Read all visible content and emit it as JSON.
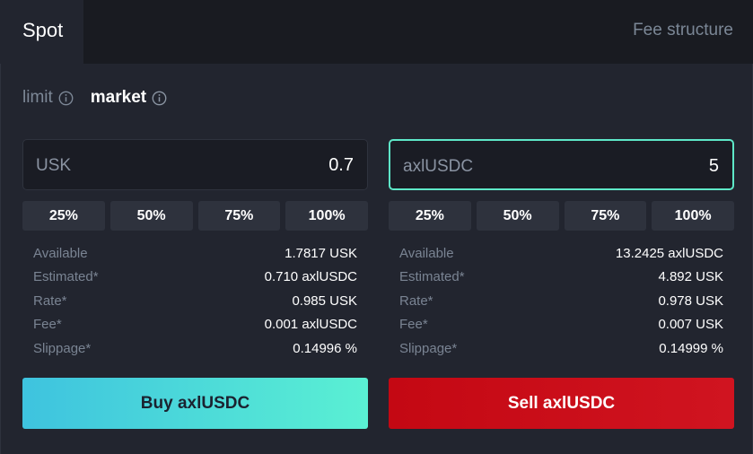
{
  "tabs": {
    "active": "Spot",
    "fee_link": "Fee structure"
  },
  "modes": {
    "limit": "limit",
    "market": "market",
    "selected": "market"
  },
  "colors": {
    "accent": "#5ee8c8",
    "buy": "#4ad8d8",
    "sell": "#c40813",
    "background": "#22252f"
  },
  "left": {
    "asset": "USK",
    "amount": "0.7",
    "percent_buttons": [
      "25%",
      "50%",
      "75%",
      "100%"
    ],
    "rows": [
      {
        "label": "Available",
        "value": "1.7817 USK"
      },
      {
        "label": "Estimated*",
        "value": "0.710 axlUSDC"
      },
      {
        "label": "Rate*",
        "value": "0.985 USK"
      },
      {
        "label": "Fee*",
        "value": "0.001 axlUSDC"
      },
      {
        "label": "Slippage*",
        "value": "0.14996 %"
      }
    ],
    "action": "Buy axlUSDC"
  },
  "right": {
    "asset": "axlUSDC",
    "amount": "5",
    "percent_buttons": [
      "25%",
      "50%",
      "75%",
      "100%"
    ],
    "rows": [
      {
        "label": "Available",
        "value": "13.2425 axlUSDC"
      },
      {
        "label": "Estimated*",
        "value": "4.892 USK"
      },
      {
        "label": "Rate*",
        "value": "0.978 USK"
      },
      {
        "label": "Fee*",
        "value": "0.007 USK"
      },
      {
        "label": "Slippage*",
        "value": "0.14999 %"
      }
    ],
    "action": "Sell axlUSDC"
  }
}
